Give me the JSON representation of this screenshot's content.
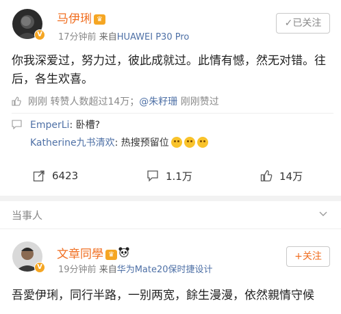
{
  "post1": {
    "author": "马伊琍",
    "time": "17分钟前",
    "source_prefix": "来自",
    "source": "HUAWEI P30 Pro",
    "follow_label": "已关注",
    "text": "你我深爱过，努力过，彼此成就过。此情有憾，然无对错。往后，各生欢喜。",
    "likes": {
      "time": "刚刚",
      "text": "转赞人数超过14万；",
      "mention": "@朱籽珊",
      "suffix": "刚刚赞过"
    },
    "comments": [
      {
        "name": "EmperLi",
        "text": ": 卧槽?"
      },
      {
        "name": "Katherine九书清欢",
        "text": ": 热搜预留位"
      }
    ],
    "actions": {
      "repost": "6423",
      "comment": "1.1万",
      "like": "14万"
    }
  },
  "section": {
    "title": "当事人"
  },
  "post2": {
    "author": "文章同學",
    "time": "19分钟前",
    "source_prefix": "来自",
    "source": "华为Mate20保时捷设计",
    "follow_label": "+关注",
    "text": "吾愛伊琍，同行半路，一别两宽，餘生漫漫，依然親情守候"
  },
  "colors": {
    "accent": "#f06d1f",
    "link": "#4e70a6",
    "vip": "#f5a623"
  }
}
